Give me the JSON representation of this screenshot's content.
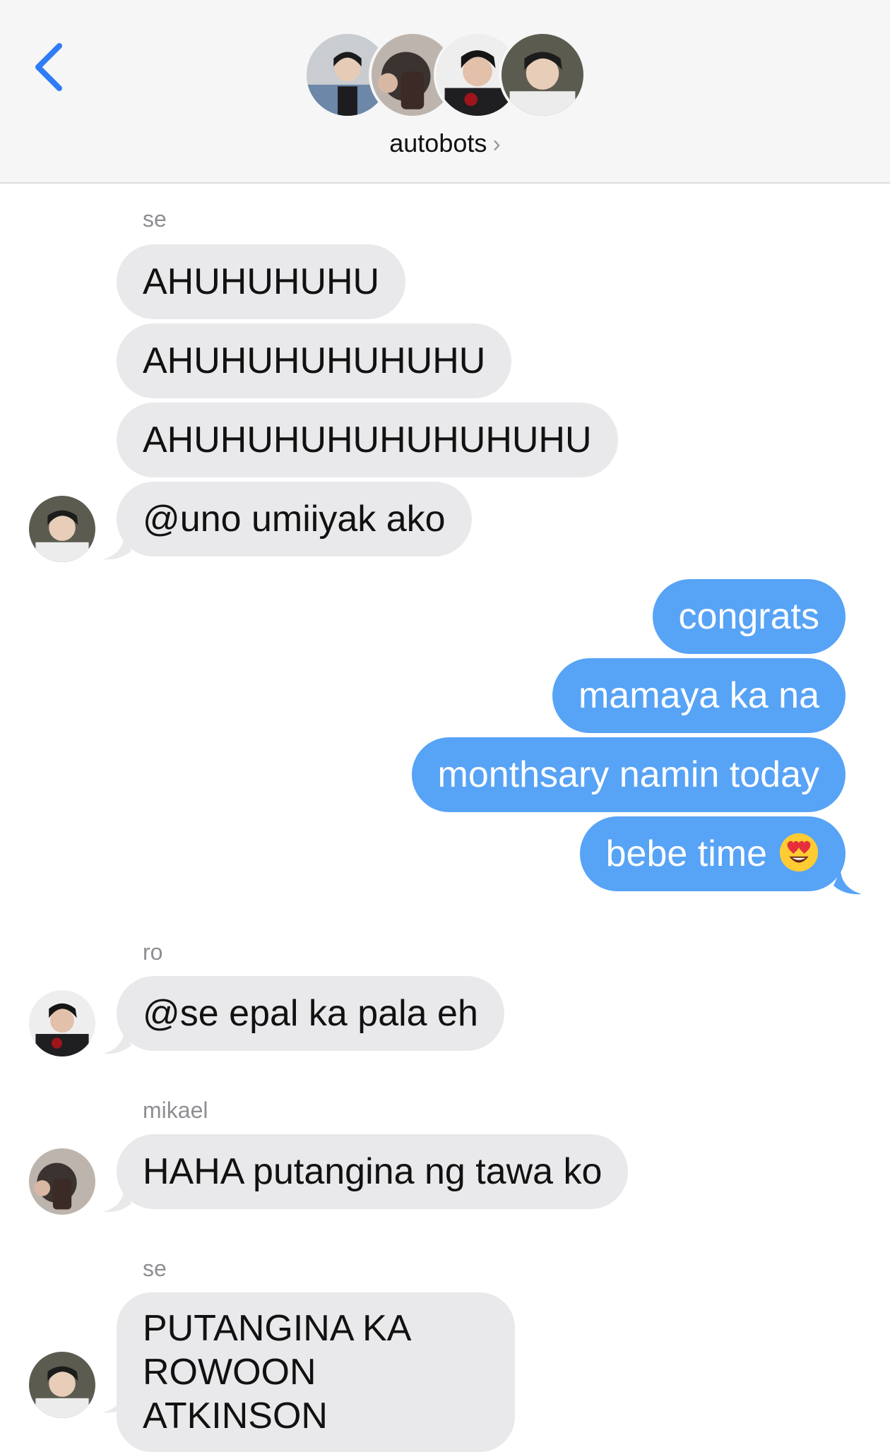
{
  "header": {
    "group_name": "autobots",
    "chevron": "›",
    "back_icon": "chevron-left-icon"
  },
  "colors": {
    "incoming_bubble": "#e9e9eb",
    "outgoing_bubble": "#57a3f6",
    "accent": "#2f7cf6"
  },
  "messages": [
    {
      "sender": "se",
      "from": "them",
      "lines": [
        "AHUHUHUHU",
        "AHUHUHUHUHUHU",
        "AHUHUHUHUHUHUHUHU",
        "@uno umiiyak ako"
      ]
    },
    {
      "from": "me",
      "lines": [
        "congrats",
        "mamaya ka na",
        "monthsary namin today",
        "bebe time"
      ],
      "last_emoji": "heart-eyes-emoji"
    },
    {
      "sender": "ro",
      "from": "them",
      "lines": [
        "@se epal ka pala eh"
      ]
    },
    {
      "sender": "mikael",
      "from": "them",
      "lines": [
        "HAHA putangina ng tawa ko"
      ]
    },
    {
      "sender": "se",
      "from": "them",
      "lines": [
        "PUTANGINA KA ROWOON ATKINSON"
      ]
    }
  ]
}
